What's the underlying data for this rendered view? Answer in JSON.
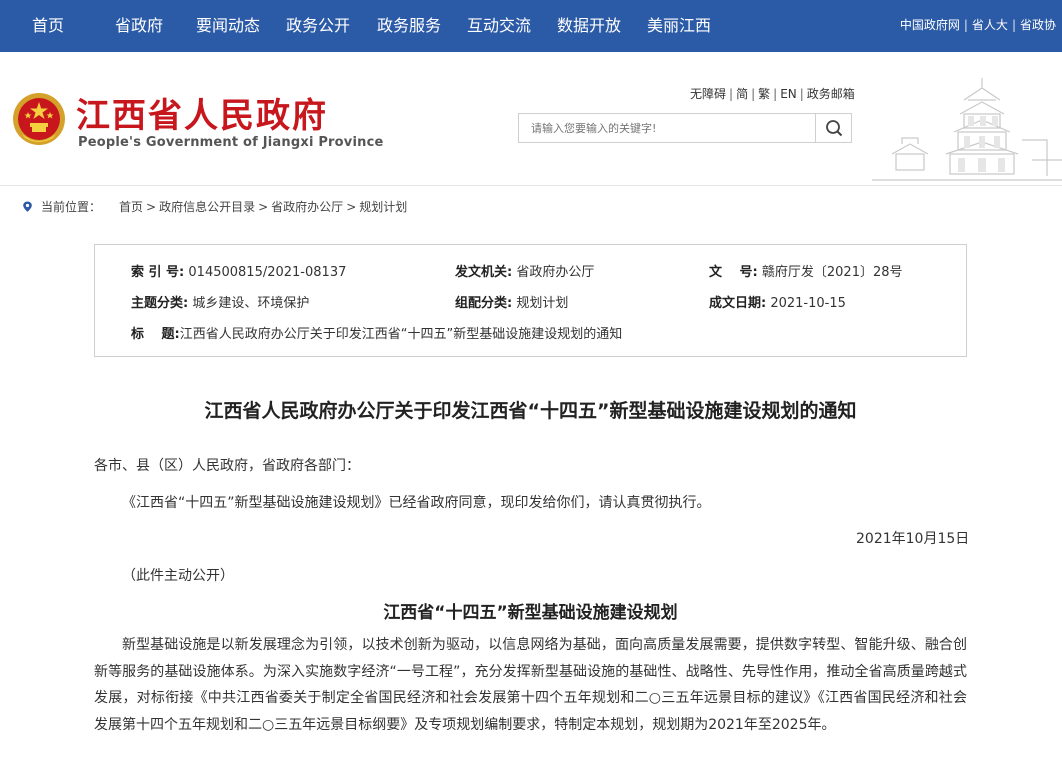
{
  "topnav": {
    "items": [
      "首页",
      "省政府",
      "要闻动态",
      "政务公开",
      "政务服务",
      "互动交流",
      "数据开放",
      "美丽江西"
    ],
    "links": [
      "中国政府网",
      "省人大",
      "省政协"
    ]
  },
  "header": {
    "title": "江西省人民政府",
    "subtitle": "People's Government of Jiangxi Province",
    "tools": [
      "无障碍",
      "简",
      "繁",
      "EN",
      "政务邮箱"
    ],
    "search_placeholder": "请输入您要输入的关键字!"
  },
  "breadcrumb": {
    "label": "当前位置：",
    "items": [
      "首页",
      "政府信息公开目录",
      "省政府办公厅",
      "规划计划"
    ]
  },
  "info": {
    "index_label": "索 引 号:",
    "index_value": "014500815/2021-08137",
    "issuer_label": "发文机关:",
    "issuer_value": "省政府办公厅",
    "docno_label": "文　 号:",
    "docno_value": "赣府厅发〔2021〕28号",
    "topic_label": "主题分类:",
    "topic_value": "城乡建设、环境保护",
    "category_label": "组配分类:",
    "category_value": "规划计划",
    "date_label": "成文日期:",
    "date_value": "2021-10-15",
    "title_label": "标　 题:",
    "title_value": "江西省人民政府办公厅关于印发江西省“十四五”新型基础设施建设规划的通知"
  },
  "content": {
    "title": "江西省人民政府办公厅关于印发江西省“十四五”新型基础设施建设规划的通知",
    "salutation": "各市、县（区）人民政府，省政府各部门：",
    "para1": "《江西省“十四五”新型基础设施建设规划》已经省政府同意，现印发给你们，请认真贯彻执行。",
    "date": "2021年10月15日",
    "note": "（此件主动公开）",
    "sub_title": "江西省“十四五”新型基础设施建设规划",
    "body": "新型基础设施是以新发展理念为引领，以技术创新为驱动，以信息网络为基础，面向高质量发展需要，提供数字转型、智能升级、融合创新等服务的基础设施体系。为深入实施数字经济“一号工程”，充分发挥新型基础设施的基础性、战略性、先导性作用，推动全省高质量跨越式发展，对标衔接《中共江西省委关于制定全省国民经济和社会发展第十四个五年规划和二○三五年远景目标的建议》《江西省国民经济和社会发展第十四个五年规划和二○三五年远景目标纲要》及专项规划编制要求，特制定本规划，规划期为2021年至2025年。"
  },
  "colors": {
    "nav_bg": "#2b5aa7",
    "title_red": "#c8161d"
  }
}
